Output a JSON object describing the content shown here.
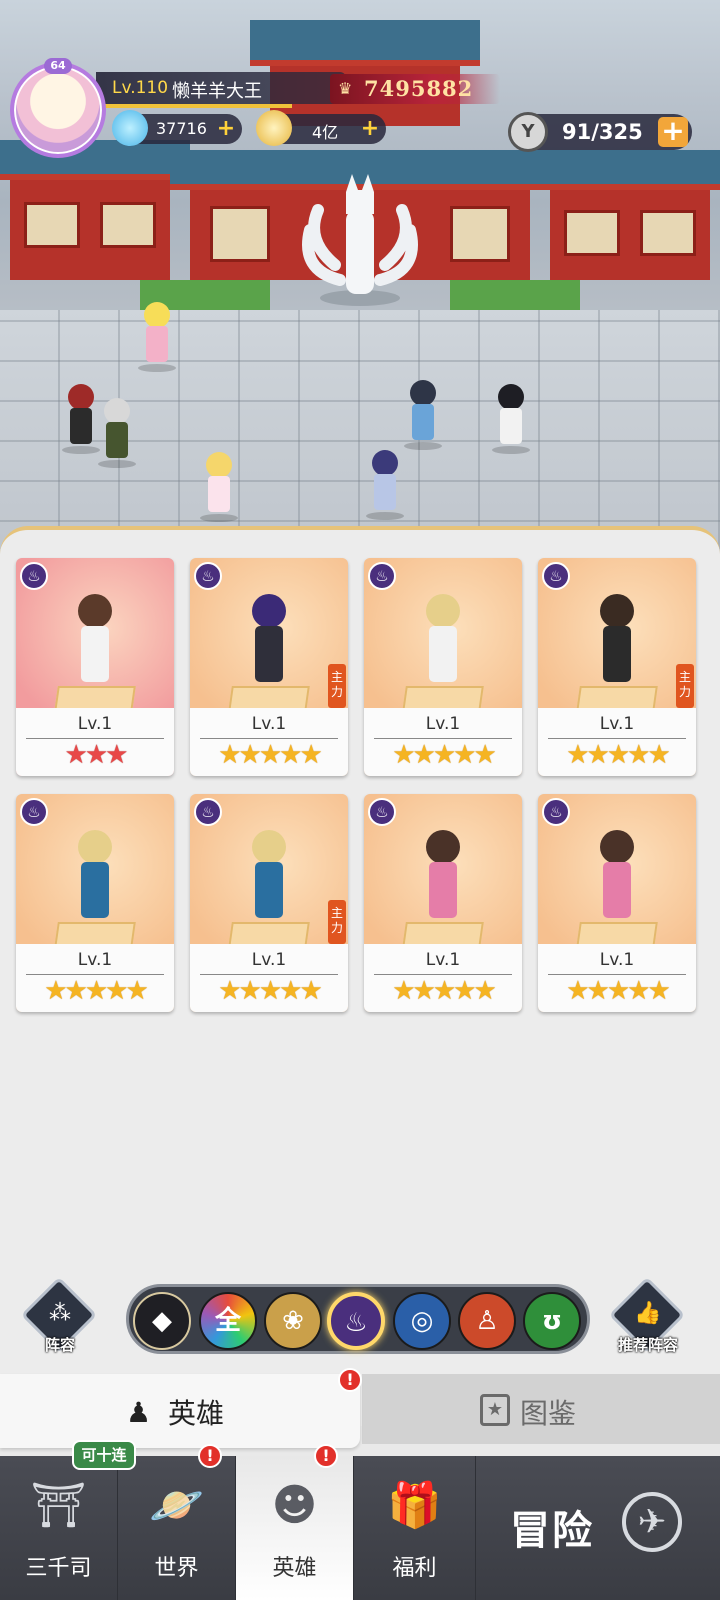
{
  "player": {
    "avatar_level": "64",
    "level": "Lv.110",
    "name": "懒羊羊大王",
    "power": "7495882",
    "diamonds": "37716",
    "gold": "4亿",
    "energy": "91/325"
  },
  "filters": {
    "formation_label": "阵容",
    "recommend_label": "推荐阵容",
    "buttons": [
      {
        "icon": "diamond-class-icon",
        "text": ""
      },
      {
        "icon": "all-icon",
        "text": "全"
      },
      {
        "icon": "lotus-icon",
        "text": ""
      },
      {
        "icon": "dark-flame-icon",
        "text": "",
        "selected": true
      },
      {
        "icon": "water-swirl-icon",
        "text": ""
      },
      {
        "icon": "meditation-icon",
        "text": ""
      },
      {
        "icon": "dna-icon",
        "text": ""
      }
    ]
  },
  "heroes": [
    {
      "level": "Lv.1",
      "stars": "★★★",
      "star_count": 3,
      "star_color": "red",
      "card_color": "red",
      "main": false,
      "main_label": ""
    },
    {
      "level": "Lv.1",
      "stars": "★★★★★",
      "star_count": 5,
      "star_color": "gold",
      "card_color": "orange",
      "main": true,
      "main_label": "主力"
    },
    {
      "level": "Lv.1",
      "stars": "★★★★★",
      "star_count": 5,
      "star_color": "gold",
      "card_color": "orange",
      "main": false,
      "main_label": ""
    },
    {
      "level": "Lv.1",
      "stars": "★★★★★",
      "star_count": 5,
      "star_color": "gold",
      "card_color": "orange",
      "main": true,
      "main_label": "主力"
    },
    {
      "level": "Lv.1",
      "stars": "★★★★★",
      "star_count": 5,
      "star_color": "gold",
      "card_color": "orange",
      "main": false,
      "main_label": ""
    },
    {
      "level": "Lv.1",
      "stars": "★★★★★",
      "star_count": 5,
      "star_color": "gold",
      "card_color": "orange",
      "main": true,
      "main_label": "主力"
    },
    {
      "level": "Lv.1",
      "stars": "★★★★★",
      "star_count": 5,
      "star_color": "gold",
      "card_color": "orange",
      "main": false,
      "main_label": ""
    },
    {
      "level": "Lv.1",
      "stars": "★★★★★",
      "star_count": 5,
      "star_color": "gold",
      "card_color": "orange",
      "main": false,
      "main_label": ""
    }
  ],
  "tabs": {
    "hero": "英雄",
    "dex": "图鉴",
    "badge": "!"
  },
  "nav": {
    "ten_pull": "可十连",
    "items": [
      {
        "label": "三千司",
        "icon": "temple-icon"
      },
      {
        "label": "世界",
        "icon": "planet-icon",
        "badge": "!"
      },
      {
        "label": "英雄",
        "icon": "hero-head-icon",
        "badge": "!"
      },
      {
        "label": "福利",
        "icon": "gift-box-icon"
      }
    ],
    "adventure": "冒险"
  },
  "colors": {
    "power_red": "#b8243a",
    "star_gold": "#f5b422",
    "star_red": "#e84848",
    "selected_ring": "#ffd86a"
  }
}
